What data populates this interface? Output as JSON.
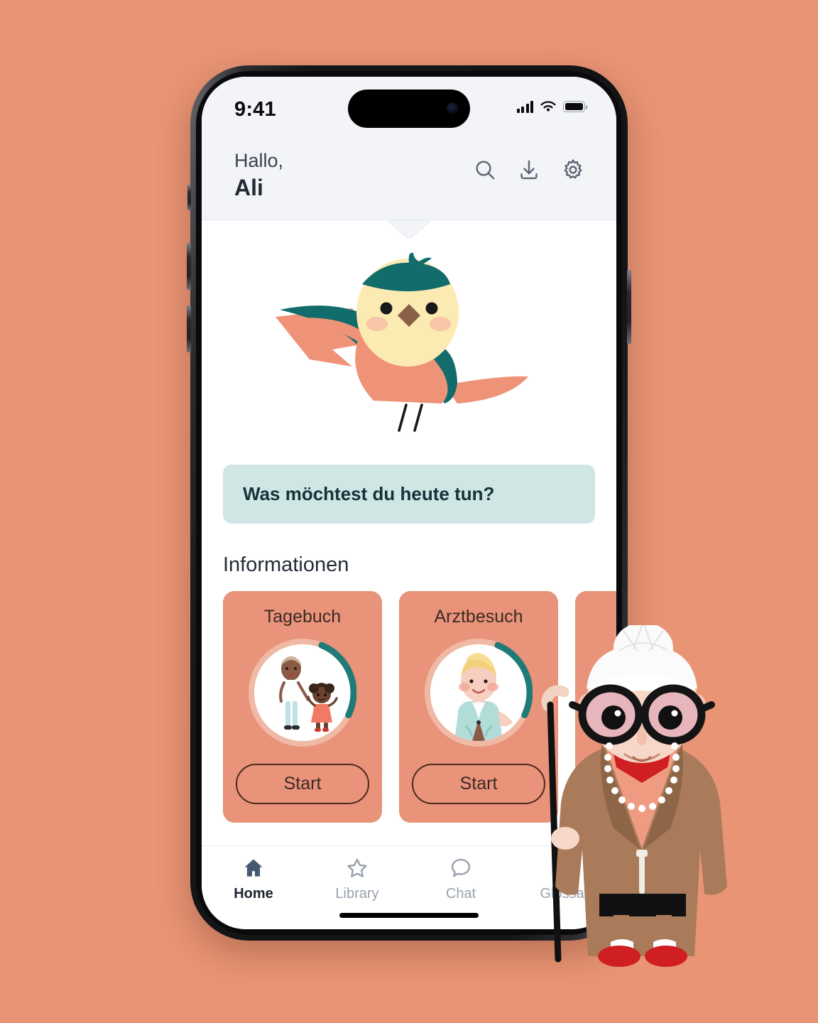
{
  "theme": {
    "background": "#e89475",
    "header_bg": "#f2f4f7",
    "card_bg": "#e8937a",
    "bubble_bg": "#cfe6e4",
    "bubble_text": "#16323a",
    "accent_teal": "#1f7a78",
    "ring_light": "#f0b9a5",
    "outline_dark": "#4a2b1e",
    "nav_active": "#1d2430",
    "nav_inactive": "#99a1ad"
  },
  "status_bar": {
    "time": "9:41",
    "signal_icon": "cellular-bars-icon",
    "wifi_icon": "wifi-icon",
    "battery_icon": "battery-icon"
  },
  "header": {
    "greeting": "Hallo,",
    "user_name": "Ali",
    "icons": [
      {
        "name": "search-icon",
        "label": "Suche"
      },
      {
        "name": "download-icon",
        "label": "Download"
      },
      {
        "name": "gear-icon",
        "label": "Einstellungen"
      }
    ]
  },
  "hero": {
    "mascot": "bird-mascot",
    "bubble_text": "Was möchtest du heute tun?"
  },
  "main": {
    "section_title": "Informationen",
    "cards": [
      {
        "title": "Tagebuch",
        "avatar": "mother-and-child-avatar",
        "button": "Start",
        "progress": 26
      },
      {
        "title": "Arztbesuch",
        "avatar": "senior-woman-avatar",
        "button": "Start",
        "progress": 26
      },
      {
        "title": "",
        "avatar": "",
        "button": "",
        "progress": 0
      }
    ]
  },
  "tabbar": {
    "items": [
      {
        "label": "Home",
        "icon": "home-icon",
        "active": true
      },
      {
        "label": "Library",
        "icon": "star-icon",
        "active": false
      },
      {
        "label": "Chat",
        "icon": "chat-bubble-icon",
        "active": false
      },
      {
        "label": "Glossar",
        "icon": "book-icon",
        "active": false
      }
    ]
  },
  "decoration": {
    "character": "grandma-with-cane-illustration"
  }
}
